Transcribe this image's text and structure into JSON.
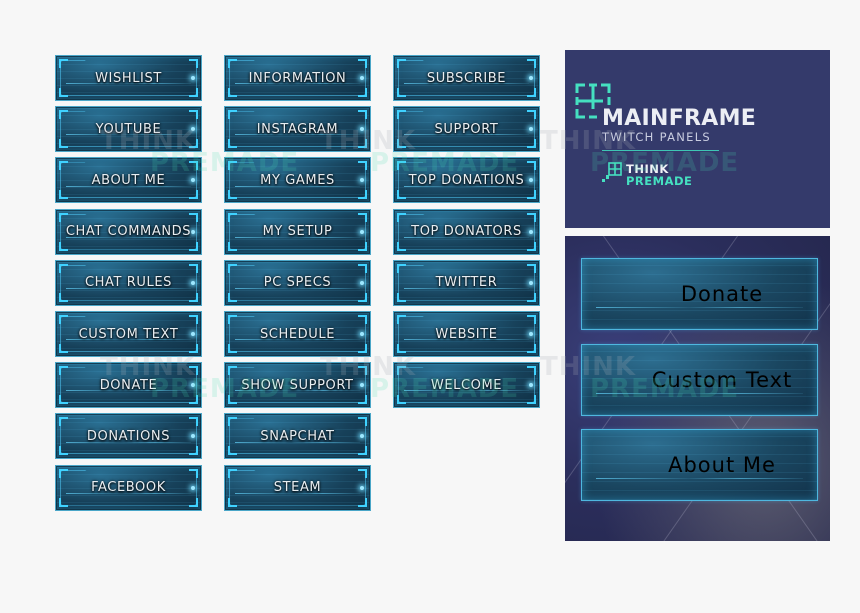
{
  "grid": {
    "columns": [
      [
        "Wishlist",
        "YouTube",
        "About Me",
        "Chat Commands",
        "Chat Rules",
        "Custom Text",
        "Donate",
        "Donations",
        "Facebook"
      ],
      [
        "Information",
        "Instagram",
        "My Games",
        "My Setup",
        "PC Specs",
        "Schedule",
        "Show Support",
        "Snapchat",
        "Steam"
      ],
      [
        "Subscribe",
        "Support",
        "Top Donations",
        "Top Donators",
        "Twitter",
        "Website",
        "Welcome"
      ]
    ]
  },
  "logo_card": {
    "title": "MAINFRAME",
    "subtitle": "TWITCH PANELS",
    "brand_line1": "THINK",
    "brand_line2": "PREMADE",
    "mark_icon": "think-premade-bracket-mark",
    "colors": {
      "background": "#343a6b",
      "accent": "#45e0c0",
      "title": "#eceef4"
    }
  },
  "preview_card": {
    "panels": [
      "Donate",
      "Custom Text",
      "About Me"
    ]
  },
  "watermark": {
    "line1": "THINK",
    "line2": "PREMADE"
  },
  "colors": {
    "page_bg": "#f7f7f7",
    "panel_border": "#4aa6c8",
    "panel_glow": "#3fd2ff",
    "panel_text": "#e8eef2"
  }
}
